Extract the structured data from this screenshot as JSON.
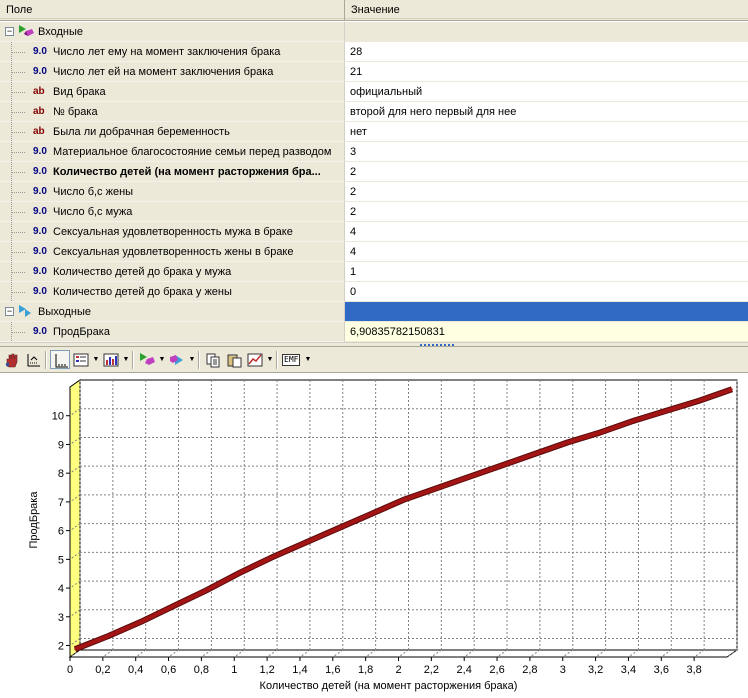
{
  "grid": {
    "columns": {
      "field": "Поле",
      "value": "Значение"
    },
    "groups": [
      {
        "label": "Входные",
        "rows": [
          {
            "tag": "9.0",
            "kind": "num",
            "label": "Число лет ему на момент заключения брака",
            "value": "28",
            "bold": false
          },
          {
            "tag": "9.0",
            "kind": "num",
            "label": "Число лет ей на момент заключения брака",
            "value": "21",
            "bold": false
          },
          {
            "tag": "ab",
            "kind": "txt",
            "label": "Вид брака",
            "value": "официальный",
            "bold": false
          },
          {
            "tag": "ab",
            "kind": "txt",
            "label": "№ брака",
            "value": "второй для него первый для нее",
            "bold": false
          },
          {
            "tag": "ab",
            "kind": "txt",
            "label": "Была ли добрачная беременность",
            "value": "нет",
            "bold": false
          },
          {
            "tag": "9.0",
            "kind": "num",
            "label": "Материальное благосостояние семьи перед разводом",
            "value": "3",
            "bold": false
          },
          {
            "tag": "9.0",
            "kind": "num",
            "label": "Количество детей (на момент расторжения бра...",
            "value": "2",
            "bold": true
          },
          {
            "tag": "9.0",
            "kind": "num",
            "label": "Число б,с жены",
            "value": "2",
            "bold": false
          },
          {
            "tag": "9.0",
            "kind": "num",
            "label": "Число б,с мужа",
            "value": "2",
            "bold": false
          },
          {
            "tag": "9.0",
            "kind": "num",
            "label": "Сексуальная удовлетворенность мужа в браке",
            "value": "4",
            "bold": false
          },
          {
            "tag": "9.0",
            "kind": "num",
            "label": "Сексуальная удовлетворенность жены в браке",
            "value": "4",
            "bold": false
          },
          {
            "tag": "9.0",
            "kind": "num",
            "label": "Количество детей до брака у мужа",
            "value": "1",
            "bold": false
          },
          {
            "tag": "9.0",
            "kind": "num",
            "label": "Количество детей до брака у жены",
            "value": "0",
            "bold": false
          }
        ]
      },
      {
        "label": "Выходные",
        "rows": [
          {
            "tag": "9.0",
            "kind": "num",
            "label": "ПродБрака",
            "value": "6,90835782150831",
            "bold": false
          }
        ]
      }
    ],
    "selected_color": "#316ac5",
    "output_value_bg": "#ffffe1"
  },
  "toolbar": {
    "buttons": [
      {
        "name": "hand-icon",
        "dropdown": false
      },
      {
        "name": "axis-scale-icon",
        "dropdown": false
      },
      {
        "name": "axes-icon",
        "dropdown": false,
        "pressed": true
      },
      {
        "name": "legend-icon",
        "dropdown": true
      },
      {
        "name": "bar-chart-icon",
        "dropdown": true
      },
      {
        "name": "input-node-icon",
        "dropdown": true
      },
      {
        "name": "output-node-icon",
        "dropdown": true
      },
      {
        "name": "copy-icon",
        "dropdown": false
      },
      {
        "name": "paste-icon",
        "dropdown": false
      },
      {
        "name": "line-chart-icon",
        "dropdown": true
      },
      {
        "name": "emf-export-icon",
        "dropdown": true
      }
    ],
    "emf_label": "EMF"
  },
  "chart_data": {
    "type": "line",
    "title": "",
    "xlabel": "Количество детей (на момент расторжения брака)",
    "ylabel": "ПродБрака",
    "xlim": [
      0,
      4
    ],
    "ylim": [
      1.6,
      11
    ],
    "x_ticks": [
      "0",
      "0,2",
      "0,4",
      "0,6",
      "0,8",
      "1",
      "1,2",
      "1,4",
      "1,6",
      "1,8",
      "2",
      "2,2",
      "2,4",
      "2,6",
      "2,8",
      "3",
      "3,2",
      "3,4",
      "3,6",
      "3,8"
    ],
    "y_ticks": [
      "2",
      "3",
      "4",
      "5",
      "6",
      "7",
      "8",
      "9",
      "10"
    ],
    "series": [
      {
        "color": "#a31515",
        "x": [
          0,
          0.2,
          0.4,
          0.6,
          0.8,
          1.0,
          1.2,
          1.4,
          1.6,
          1.8,
          2.0,
          2.2,
          2.4,
          2.6,
          2.8,
          3.0,
          3.2,
          3.4,
          3.6,
          3.8,
          4.0
        ],
        "y": [
          1.75,
          2.2,
          2.7,
          3.25,
          3.8,
          4.4,
          4.95,
          5.45,
          5.95,
          6.45,
          6.95,
          7.35,
          7.75,
          8.15,
          8.55,
          8.95,
          9.3,
          9.7,
          10.05,
          10.4,
          10.8
        ]
      }
    ],
    "grid": true,
    "wall_color": "#ffff80"
  }
}
